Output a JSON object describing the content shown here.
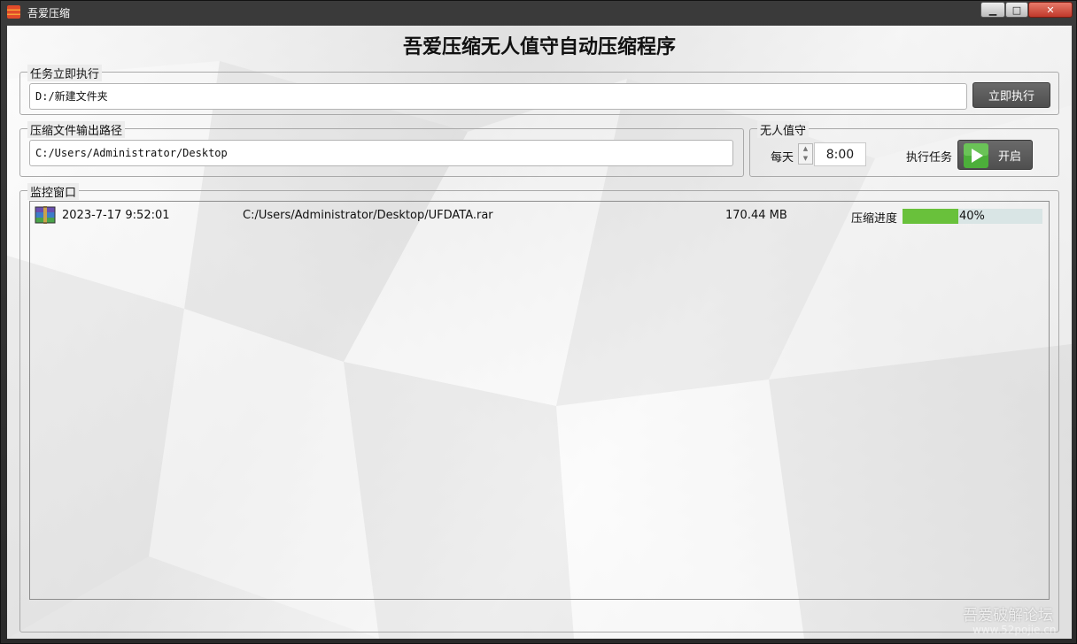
{
  "window": {
    "title": "吾爱压缩",
    "min_glyph": "▁",
    "max_glyph": "□",
    "close_glyph": "✕"
  },
  "main_title": "吾爱压缩无人值守自动压缩程序",
  "task_group": {
    "legend": "任务立即执行",
    "path_value": "D:/新建文件夹",
    "run_button": "立即执行"
  },
  "output_group": {
    "legend": "压缩文件输出路径",
    "path_value": "C:/Users/Administrator/Desktop"
  },
  "unattended_group": {
    "legend": "无人值守",
    "daily_label": "每天",
    "time_value": "8:00",
    "task_label": "执行任务",
    "start_button": "开启"
  },
  "monitor_group": {
    "legend": "监控窗口",
    "rows": [
      {
        "icon": "winrar-archive-icon",
        "time": "2023-7-17 9:52:01",
        "path": "C:/Users/Administrator/Desktop/UFDATA.rar",
        "size": "170.44 MB",
        "progress_label": "压缩进度",
        "progress": 0.4,
        "progress_text": "40%"
      }
    ]
  },
  "watermark": {
    "text": "吾爱破解论坛",
    "url": "www.52pojie.cn"
  },
  "colors": {
    "progress_fill": "#69c13b",
    "progress_track": "#d9e5e5",
    "button_dark": "#5a5a5a",
    "close_red": "#c0392b",
    "play_green": "#4caf3a"
  }
}
